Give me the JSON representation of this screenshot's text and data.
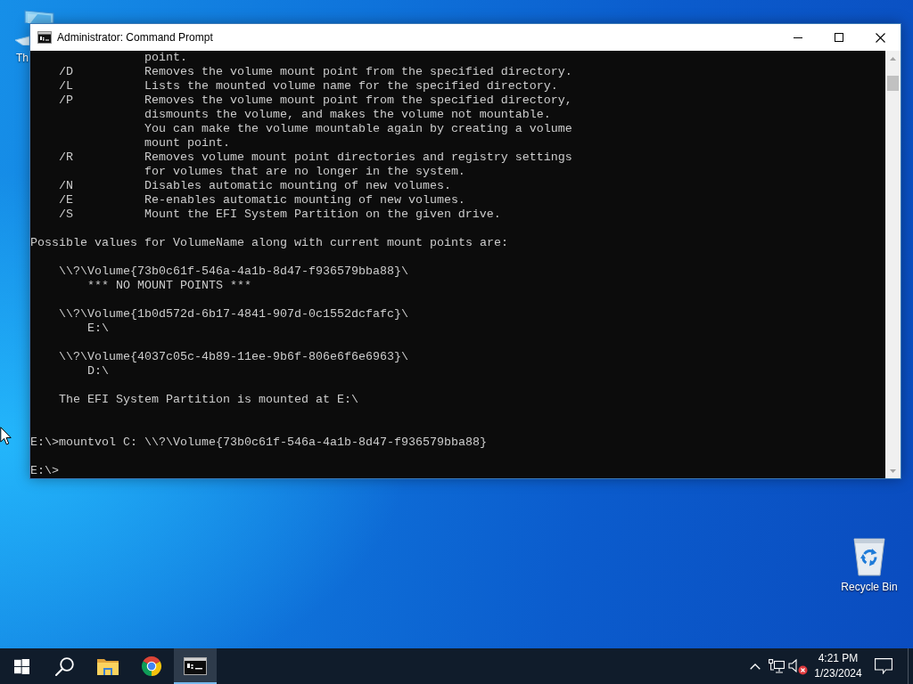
{
  "desktop": {
    "icons": [
      {
        "kind": "computer",
        "label": "Th"
      },
      {
        "kind": "recycle-bin",
        "label": "Recycle Bin"
      }
    ]
  },
  "window": {
    "title": "Administrator: Command Prompt"
  },
  "console": {
    "lines": [
      {
        "kind": "continuation",
        "text": "point."
      },
      {
        "kind": "option",
        "switch": "/D",
        "text": "Removes the volume mount point from the specified directory."
      },
      {
        "kind": "option",
        "switch": "/L",
        "text": "Lists the mounted volume name for the specified directory."
      },
      {
        "kind": "option",
        "switch": "/P",
        "text": "Removes the volume mount point from the specified directory,"
      },
      {
        "kind": "continuation",
        "text": "dismounts the volume, and makes the volume not mountable."
      },
      {
        "kind": "continuation",
        "text": "You can make the volume mountable again by creating a volume"
      },
      {
        "kind": "continuation",
        "text": "mount point."
      },
      {
        "kind": "option",
        "switch": "/R",
        "text": "Removes volume mount point directories and registry settings"
      },
      {
        "kind": "continuation",
        "text": "for volumes that are no longer in the system."
      },
      {
        "kind": "option",
        "switch": "/N",
        "text": "Disables automatic mounting of new volumes."
      },
      {
        "kind": "option",
        "switch": "/E",
        "text": "Re-enables automatic mounting of new volumes."
      },
      {
        "kind": "option",
        "switch": "/S",
        "text": "Mount the EFI System Partition on the given drive."
      },
      {
        "kind": "blank"
      },
      {
        "kind": "output",
        "text": "Possible values for VolumeName along with current mount points are:"
      },
      {
        "kind": "blank"
      },
      {
        "kind": "volume",
        "text": "\\\\?\\Volume{73b0c61f-546a-4a1b-8d47-f936579bba88}\\"
      },
      {
        "kind": "mount",
        "text": "*** NO MOUNT POINTS ***"
      },
      {
        "kind": "blank"
      },
      {
        "kind": "volume",
        "text": "\\\\?\\Volume{1b0d572d-6b17-4841-907d-0c1552dcfafc}\\"
      },
      {
        "kind": "mount",
        "text": "E:\\"
      },
      {
        "kind": "blank"
      },
      {
        "kind": "volume",
        "text": "\\\\?\\Volume{4037c05c-4b89-11ee-9b6f-806e6f6e6963}\\"
      },
      {
        "kind": "mount",
        "text": "D:\\"
      },
      {
        "kind": "blank"
      },
      {
        "kind": "note",
        "text": "The EFI System Partition is mounted at E:\\"
      },
      {
        "kind": "blank"
      },
      {
        "kind": "blank"
      },
      {
        "kind": "command",
        "text": "E:\\>mountvol C: \\\\?\\Volume{73b0c61f-546a-4a1b-8d47-f936579bba88}"
      },
      {
        "kind": "blank"
      },
      {
        "kind": "command",
        "text": "E:\\>"
      }
    ]
  },
  "taskbar": {
    "apps": [
      {
        "kind": "folder",
        "active": false
      },
      {
        "kind": "browser",
        "active": false
      },
      {
        "kind": "terminal",
        "active": true
      }
    ],
    "clock": {
      "time": "4:21 PM",
      "date": "1/23/2024"
    }
  }
}
